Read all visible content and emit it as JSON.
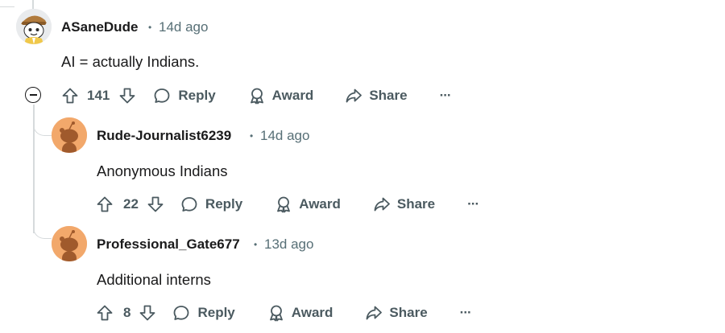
{
  "comments": [
    {
      "username": "ASaneDude",
      "time": "14d ago",
      "body": "AI = actually Indians.",
      "votes": "141",
      "reply_label": "Reply",
      "award_label": "Award",
      "share_label": "Share",
      "more_label": "···"
    },
    {
      "username": "Rude-Journalist6239",
      "time": "14d ago",
      "body": "Anonymous Indians",
      "votes": "22",
      "reply_label": "Reply",
      "award_label": "Award",
      "share_label": "Share",
      "more_label": "···"
    },
    {
      "username": "Professional_Gate677",
      "time": "13d ago",
      "body": "Additional interns",
      "votes": "8",
      "reply_label": "Reply",
      "award_label": "Award",
      "share_label": "Share",
      "more_label": "···"
    }
  ],
  "colors": {
    "text": "#1a1a1b",
    "meta": "#576f76",
    "action": "#4b5a60",
    "thread_line": "#d6dadc",
    "avatar_orange": "#f2a86b"
  }
}
